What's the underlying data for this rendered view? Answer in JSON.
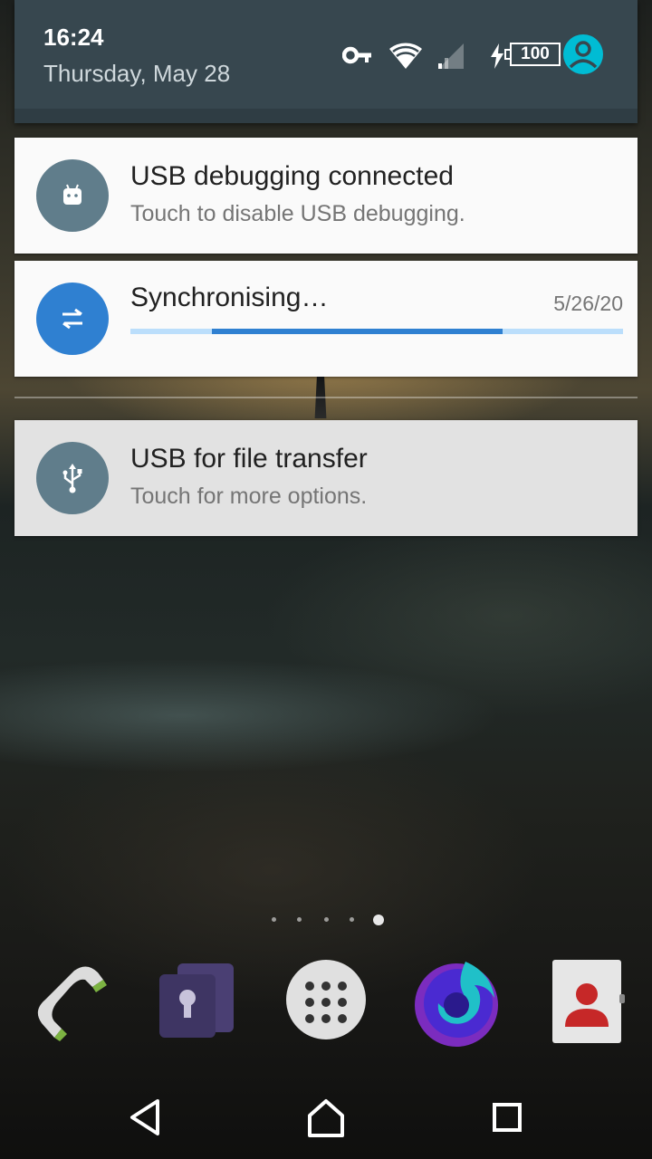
{
  "status_bar": {
    "time": "16:24",
    "date": "Thursday, May 28",
    "battery": "100",
    "icons": [
      "vpn-key-icon",
      "wifi-icon",
      "cellular-signal-icon",
      "charging-bolt-icon",
      "battery-icon",
      "user-avatar-icon"
    ]
  },
  "notifications": [
    {
      "title": "USB debugging connected",
      "text": "Touch to disable USB debugging.",
      "icon": "android-debug-icon",
      "icon_color": "#607d8b"
    },
    {
      "title": "Synchronising…",
      "time": "5/26/20",
      "icon": "sync-icon",
      "icon_color": "#2f80d1",
      "progress_start": 0.165,
      "progress_end": 0.755
    },
    {
      "title": "USB for file transfer",
      "text": "Touch for more options.",
      "icon": "usb-icon",
      "icon_color": "#607d8b"
    }
  ],
  "home": {
    "page_count": 5,
    "active_page": 5,
    "dock": [
      "phone-app-icon",
      "lockbox-app-icon",
      "app-drawer-icon",
      "firefox-app-icon",
      "contacts-app-icon"
    ]
  },
  "nav": [
    "back-icon",
    "home-icon",
    "recents-icon"
  ],
  "colors": {
    "header": "#37474f",
    "accent": "#00bcd4",
    "progress": "#2f80d1",
    "progress_track": "#bbdefb"
  }
}
